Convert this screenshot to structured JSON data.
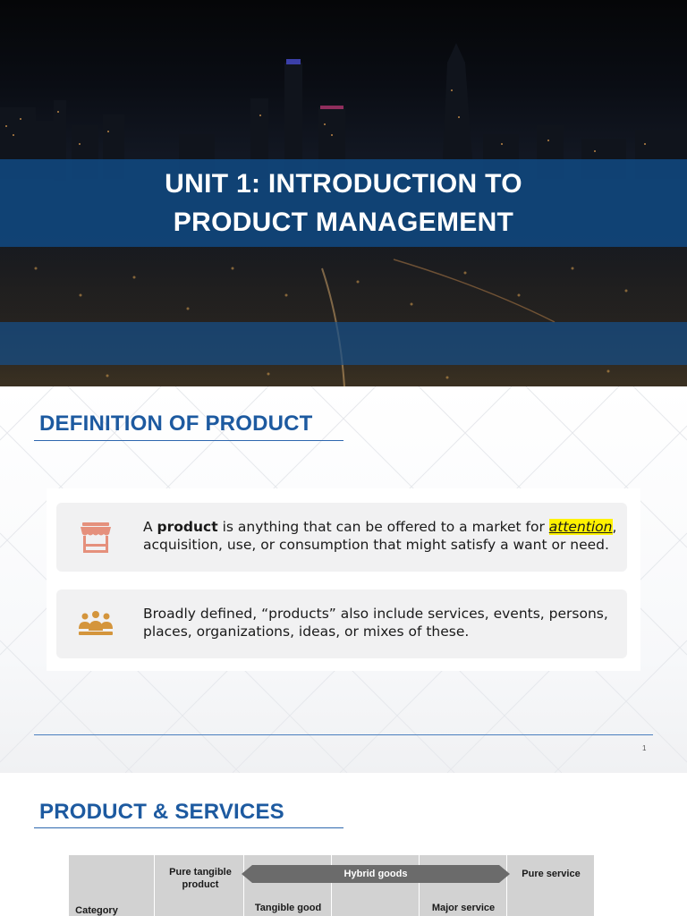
{
  "slide1": {
    "title": "UNIT 1: INTRODUCTION TO\nPRODUCT MANAGEMENT"
  },
  "slide2": {
    "heading": "DEFINITION OF PRODUCT",
    "card1": {
      "icon": "market-stall-icon",
      "text_before": "A ",
      "bold": "product",
      "text_middle": " is anything that can be offered to a market for ",
      "highlight": "attention",
      "text_after": ", acquisition, use, or consumption that might satisfy a want or need."
    },
    "card2": {
      "icon": "people-group-icon",
      "text": "Broadly defined, “products” also include services, events, persons, places, organizations, ideas, or mixes of these."
    },
    "page_number": "1"
  },
  "slide3": {
    "heading": "PRODUCT & SERVICES",
    "table": {
      "category_label": "Category",
      "pure_tangible": "Pure tangible\nproduct",
      "hybrid": "Hybrid goods",
      "pure_service": "Pure service",
      "tangible_good": "Tangible good",
      "major_service": "Major service"
    }
  },
  "colors": {
    "title_band": "#104880",
    "heading": "#1d5aa0",
    "highlight": "#fff200",
    "card": "#f1f1f2",
    "icon_stall": "#e5907c",
    "icon_people": "#d4953c"
  }
}
